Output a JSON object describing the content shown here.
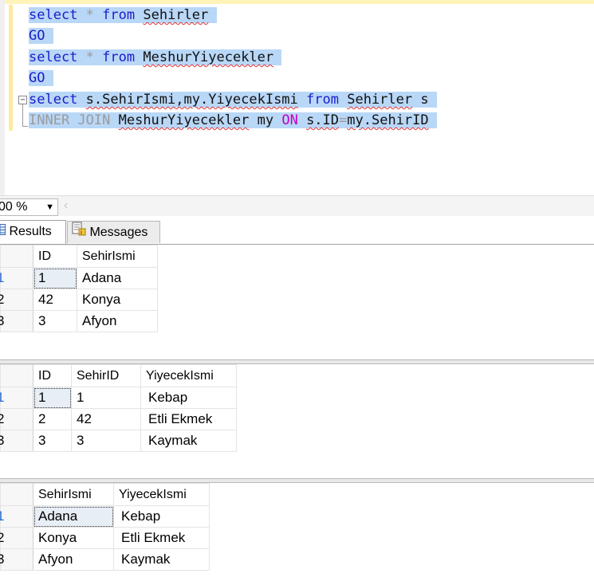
{
  "editor": {
    "lines": [
      {
        "parts": [
          {
            "t": "select",
            "c": "kw"
          },
          {
            "t": " ",
            "c": "blk"
          },
          {
            "t": "*",
            "c": "gray"
          },
          {
            "t": " ",
            "c": "blk"
          },
          {
            "t": "from",
            "c": "kw"
          },
          {
            "t": " ",
            "c": "blk"
          },
          {
            "t": "Sehirler",
            "c": "blk sq"
          }
        ]
      },
      {
        "parts": [
          {
            "t": "GO",
            "c": "kw"
          }
        ]
      },
      {
        "parts": [
          {
            "t": "select",
            "c": "kw"
          },
          {
            "t": " ",
            "c": "blk"
          },
          {
            "t": "*",
            "c": "gray"
          },
          {
            "t": " ",
            "c": "blk"
          },
          {
            "t": "from",
            "c": "kw"
          },
          {
            "t": " ",
            "c": "blk"
          },
          {
            "t": "MeshurYiyecekler",
            "c": "blk sq"
          }
        ]
      },
      {
        "parts": [
          {
            "t": "GO",
            "c": "kw"
          }
        ]
      },
      {
        "parts": [
          {
            "t": "select",
            "c": "kw"
          },
          {
            "t": " ",
            "c": "blk"
          },
          {
            "t": "s.SehirIsmi,my.YiyecekIsmi",
            "c": "blk sq"
          },
          {
            "t": " ",
            "c": "blk"
          },
          {
            "t": "from",
            "c": "kw"
          },
          {
            "t": " ",
            "c": "blk"
          },
          {
            "t": "Sehirler",
            "c": "blk sq"
          },
          {
            "t": " s",
            "c": "blk"
          }
        ]
      },
      {
        "parts": [
          {
            "t": "INNER JOIN",
            "c": "gray"
          },
          {
            "t": " ",
            "c": "blk"
          },
          {
            "t": "MeshurYiyecekler",
            "c": "blk sq"
          },
          {
            "t": " my ",
            "c": "blk"
          },
          {
            "t": "ON",
            "c": "pink"
          },
          {
            "t": " ",
            "c": "blk"
          },
          {
            "t": "s.ID",
            "c": "blk sq"
          },
          {
            "t": "=",
            "c": "gray"
          },
          {
            "t": "my.SehirID",
            "c": "blk sq"
          }
        ]
      }
    ]
  },
  "zoom": {
    "value": "00 %"
  },
  "tabs": {
    "results": "Results",
    "messages": "Messages"
  },
  "grid1": {
    "columns": [
      "ID",
      "SehirIsmi"
    ],
    "rownums": [
      "1",
      "2",
      "3"
    ],
    "rows": [
      [
        "1",
        "Adana"
      ],
      [
        "42",
        "Konya"
      ],
      [
        "3",
        "Afyon"
      ]
    ]
  },
  "grid2": {
    "columns": [
      "ID",
      "SehirID",
      "YiyecekIsmi"
    ],
    "rownums": [
      "1",
      "2",
      "3"
    ],
    "rows": [
      [
        "1",
        "1",
        "Kebap"
      ],
      [
        "2",
        "42",
        "Etli Ekmek"
      ],
      [
        "3",
        "3",
        "Kaymak"
      ]
    ]
  },
  "grid3": {
    "columns": [
      "SehirIsmi",
      "YiyecekIsmi"
    ],
    "rownums": [
      "1",
      "2",
      "3"
    ],
    "rows": [
      [
        "Adana",
        "Kebap"
      ],
      [
        "Konya",
        "Etli Ekmek"
      ],
      [
        "Afyon",
        "Kaymak"
      ]
    ]
  }
}
